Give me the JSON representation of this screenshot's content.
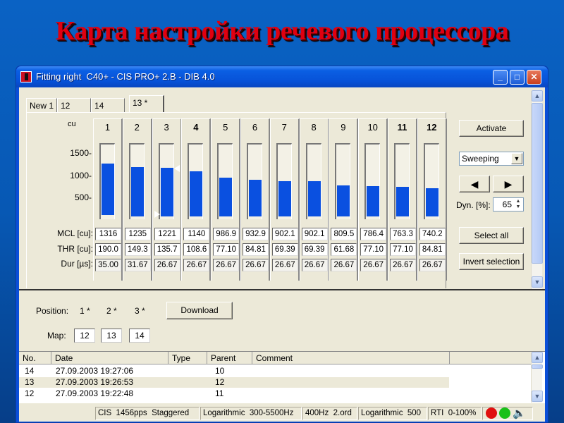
{
  "slide": {
    "title": "Карта настройки речевого процессора"
  },
  "window": {
    "title": "Fitting right  C40+ - CIS PRO+ 2.B - DIB 4.0",
    "icons": {
      "app": "app-logo-icon",
      "minimize": "minimize-icon",
      "maximize": "maximize-icon",
      "close": "close-icon"
    },
    "minimize_glyph": "_",
    "maximize_glyph": "□",
    "close_glyph": "✕"
  },
  "tabs": [
    {
      "label": "New 1",
      "active": false
    },
    {
      "label": "12",
      "active": false
    },
    {
      "label": "14",
      "active": false
    },
    {
      "label": "13 *",
      "active": true
    }
  ],
  "levels": {
    "unit_label": "cu",
    "y_ticks": [
      "1500-",
      "1000-",
      "500-"
    ],
    "row_labels": {
      "mcl": "MCL [cu]:",
      "thr": "THR [cu]:",
      "dur": "Dur [µs]:"
    },
    "scale_max_cu": 2000,
    "channels": [
      {
        "num": "1",
        "bold": false,
        "mcl": "1316",
        "thr": "190.0",
        "dur": "35.00",
        "mcl_value": 1316,
        "thr_value": 190.0
      },
      {
        "num": "2",
        "bold": false,
        "mcl": "1235",
        "thr": "149.3",
        "dur": "31.67",
        "mcl_value": 1235,
        "thr_value": 149.3
      },
      {
        "num": "3",
        "bold": false,
        "mcl": "1221",
        "thr": "135.7",
        "dur": "26.67",
        "mcl_value": 1221,
        "thr_value": 135.7,
        "selected": true
      },
      {
        "num": "4",
        "bold": true,
        "mcl": "1140",
        "thr": "108.6",
        "dur": "26.67",
        "mcl_value": 1140,
        "thr_value": 108.6
      },
      {
        "num": "5",
        "bold": false,
        "mcl": "986.9",
        "thr": "77.10",
        "dur": "26.67",
        "mcl_value": 986.9,
        "thr_value": 77.1
      },
      {
        "num": "6",
        "bold": false,
        "mcl": "932.9",
        "thr": "84.81",
        "dur": "26.67",
        "mcl_value": 932.9,
        "thr_value": 84.81
      },
      {
        "num": "7",
        "bold": false,
        "mcl": "902.1",
        "thr": "69.39",
        "dur": "26.67",
        "mcl_value": 902.1,
        "thr_value": 69.39
      },
      {
        "num": "8",
        "bold": false,
        "mcl": "902.1",
        "thr": "69.39",
        "dur": "26.67",
        "mcl_value": 902.1,
        "thr_value": 69.39
      },
      {
        "num": "9",
        "bold": false,
        "mcl": "809.5",
        "thr": "61.68",
        "dur": "26.67",
        "mcl_value": 809.5,
        "thr_value": 61.68
      },
      {
        "num": "10",
        "bold": false,
        "mcl": "786.4",
        "thr": "77.10",
        "dur": "26.67",
        "mcl_value": 786.4,
        "thr_value": 77.1
      },
      {
        "num": "11",
        "bold": true,
        "mcl": "763.3",
        "thr": "77.10",
        "dur": "26.67",
        "mcl_value": 763.3,
        "thr_value": 77.1
      },
      {
        "num": "12",
        "bold": true,
        "mcl": "740.2",
        "thr": "84.81",
        "dur": "26.67",
        "mcl_value": 740.2,
        "thr_value": 84.81
      }
    ]
  },
  "controls": {
    "activate": "Activate",
    "mode_select": "Sweeping",
    "prev_glyph": "◀",
    "next_glyph": "▶",
    "dyn_label": "Dyn. [%]:",
    "dyn_value": "65",
    "select_all": "Select all",
    "invert_selection": "Invert selection"
  },
  "positions": {
    "position_label": "Position:",
    "items": [
      "1 *",
      "2 *",
      "3 *"
    ],
    "download": "Download",
    "map_label": "Map:",
    "maps": [
      "12",
      "13",
      "14"
    ]
  },
  "history": {
    "columns": [
      "No.",
      "Date",
      "Type",
      "Parent",
      "Comment"
    ],
    "rows": [
      {
        "no": "14",
        "date": "27.09.2003 19:27:06",
        "type": "",
        "parent": "10",
        "comment": ""
      },
      {
        "no": "13",
        "date": "27.09.2003 19:26:53",
        "type": "",
        "parent": "12",
        "comment": ""
      },
      {
        "no": "12",
        "date": "27.09.2003 19:22:48",
        "type": "",
        "parent": "11",
        "comment": ""
      }
    ]
  },
  "status_bar": {
    "panels": [
      "CIS  1456pps  Staggered",
      "Logarithmic  300-5500Hz",
      "400Hz  2.ord",
      "Logarithmic  500",
      "RTI  0-100%"
    ],
    "indicators": {
      "red": "#e01010",
      "green": "#18c018"
    },
    "speaker_icon": "speaker-icon"
  },
  "colors": {
    "bar": "#0a50e0",
    "title": "#e00010",
    "titlebar": "#0752d8"
  }
}
